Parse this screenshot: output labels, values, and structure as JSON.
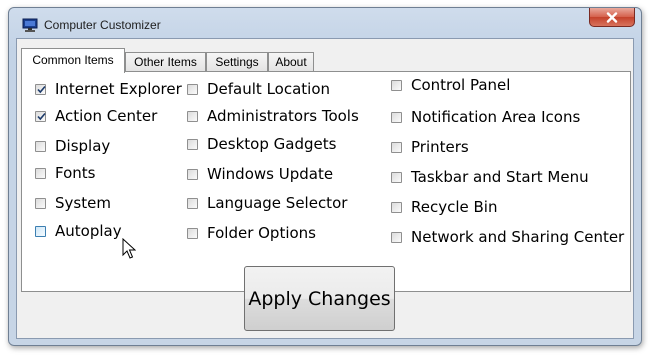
{
  "window": {
    "title": "Computer Customizer",
    "app_icon": "computer-icon",
    "close_icon": "close-icon"
  },
  "tabs": [
    {
      "label": "Common Items",
      "active": true
    },
    {
      "label": "Other Items",
      "active": false
    },
    {
      "label": "Settings",
      "active": false
    },
    {
      "label": "About",
      "active": false
    }
  ],
  "columns": [
    [
      {
        "label": "Internet Explorer",
        "checked": true
      },
      {
        "label": "Action Center",
        "checked": true
      },
      {
        "label": "Display",
        "checked": false
      },
      {
        "label": "Fonts",
        "checked": false
      },
      {
        "label": "System",
        "checked": false
      },
      {
        "label": "Autoplay",
        "checked": false
      }
    ],
    [
      {
        "label": "Default Location",
        "checked": false
      },
      {
        "label": "Administrators Tools",
        "checked": false
      },
      {
        "label": "Desktop Gadgets",
        "checked": false
      },
      {
        "label": "Windows Update",
        "checked": false
      },
      {
        "label": "Language Selector",
        "checked": false
      },
      {
        "label": "Folder Options",
        "checked": false
      }
    ],
    [
      {
        "label": "Control Panel",
        "checked": false
      },
      {
        "label": "Notification Area Icons",
        "checked": false
      },
      {
        "label": "Printers",
        "checked": false
      },
      {
        "label": "Taskbar and Start Menu",
        "checked": false
      },
      {
        "label": "Recycle Bin",
        "checked": false
      },
      {
        "label": "Network and Sharing Center",
        "checked": false
      }
    ]
  ],
  "apply_button": {
    "label": "Apply Changes"
  }
}
